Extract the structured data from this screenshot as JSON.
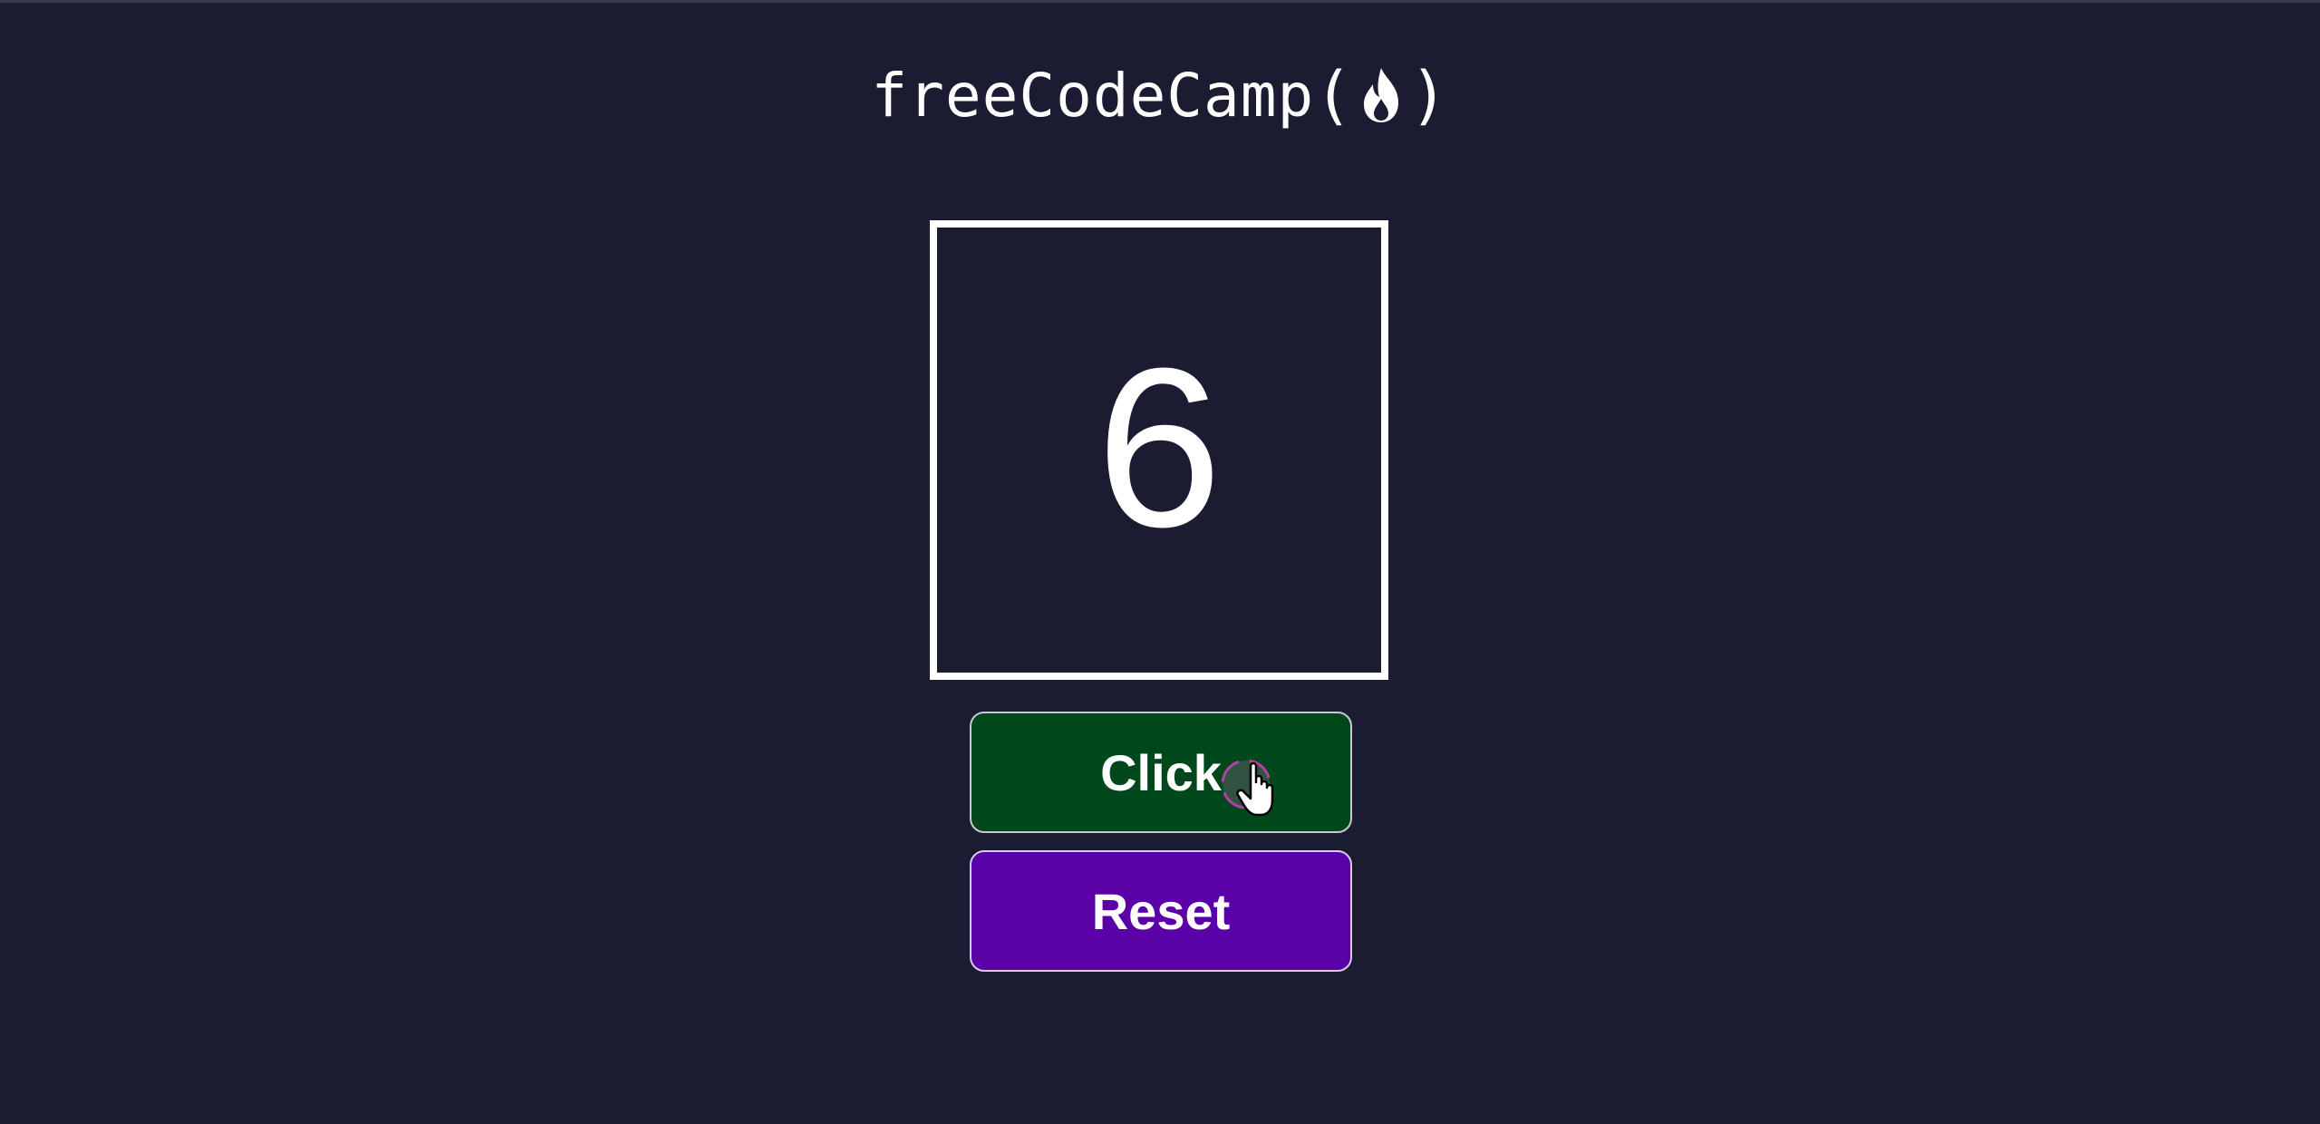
{
  "logo": {
    "text": "freeCodeCamp",
    "open_paren": "(",
    "close_paren": ")",
    "icon": "flame-icon"
  },
  "counter": {
    "value": "6"
  },
  "buttons": {
    "click_label": "Click",
    "reset_label": "Reset"
  },
  "colors": {
    "background": "#1b1b32",
    "click_button": "#00471b",
    "reset_button": "#5a01a7",
    "counter_border": "#ffffff"
  },
  "cursor": {
    "icon": "hand-pointer-icon"
  }
}
